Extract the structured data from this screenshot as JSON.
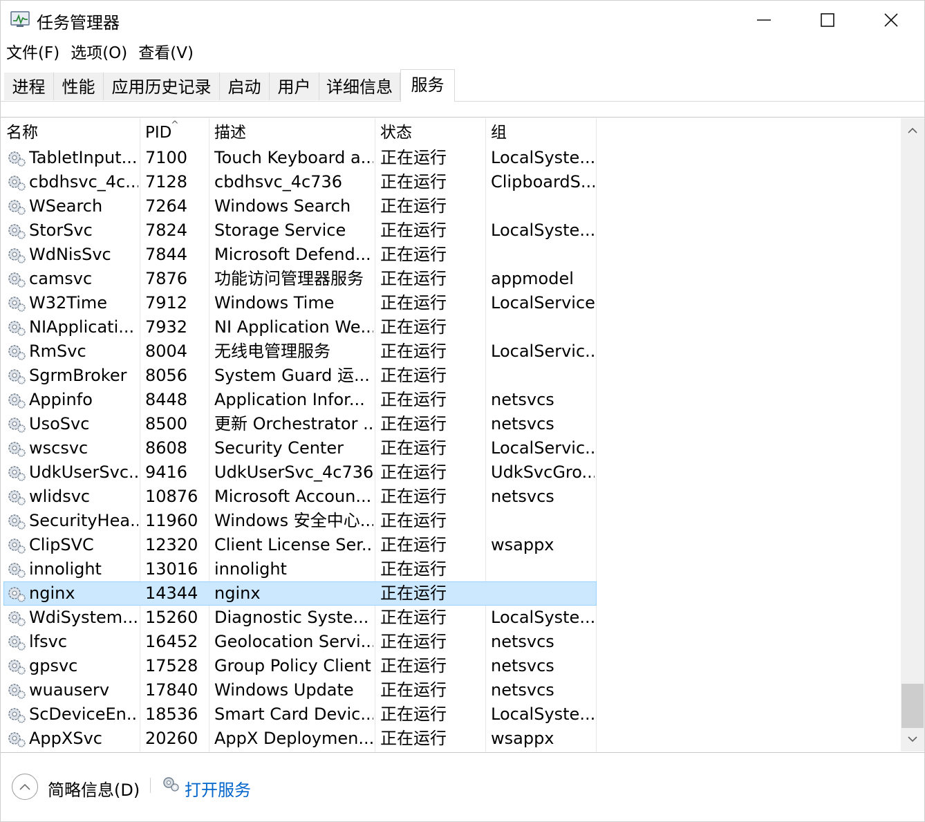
{
  "window": {
    "title": "任务管理器"
  },
  "menu": [
    "文件(F)",
    "选项(O)",
    "查看(V)"
  ],
  "tabs": [
    {
      "label": "进程"
    },
    {
      "label": "性能"
    },
    {
      "label": "应用历史记录"
    },
    {
      "label": "启动"
    },
    {
      "label": "用户"
    },
    {
      "label": "详细信息"
    },
    {
      "label": "服务",
      "active": true
    }
  ],
  "table": {
    "columns": {
      "name": "名称",
      "pid": "PID",
      "desc": "描述",
      "status": "状态",
      "group": "组"
    },
    "sort_indicator": "^",
    "row_icon": "service-gear-icon",
    "selected_index": 18,
    "rows": [
      {
        "name": "TabletInput...",
        "pid": "7100",
        "desc": "Touch Keyboard a...",
        "status": "正在运行",
        "group": "LocalSyste..."
      },
      {
        "name": "cbdhsvc_4c...",
        "pid": "7128",
        "desc": "cbdhsvc_4c736",
        "status": "正在运行",
        "group": "ClipboardS..."
      },
      {
        "name": "WSearch",
        "pid": "7264",
        "desc": "Windows Search",
        "status": "正在运行",
        "group": ""
      },
      {
        "name": "StorSvc",
        "pid": "7824",
        "desc": "Storage Service",
        "status": "正在运行",
        "group": "LocalSyste..."
      },
      {
        "name": "WdNisSvc",
        "pid": "7844",
        "desc": "Microsoft Defend...",
        "status": "正在运行",
        "group": ""
      },
      {
        "name": "camsvc",
        "pid": "7876",
        "desc": "功能访问管理器服务",
        "status": "正在运行",
        "group": "appmodel"
      },
      {
        "name": "W32Time",
        "pid": "7912",
        "desc": "Windows Time",
        "status": "正在运行",
        "group": "LocalService"
      },
      {
        "name": "NIApplicati...",
        "pid": "7932",
        "desc": "NI Application We...",
        "status": "正在运行",
        "group": ""
      },
      {
        "name": "RmSvc",
        "pid": "8004",
        "desc": "无线电管理服务",
        "status": "正在运行",
        "group": "LocalServic..."
      },
      {
        "name": "SgrmBroker",
        "pid": "8056",
        "desc": "System Guard 运...",
        "status": "正在运行",
        "group": ""
      },
      {
        "name": "Appinfo",
        "pid": "8448",
        "desc": "Application Infor...",
        "status": "正在运行",
        "group": "netsvcs"
      },
      {
        "name": "UsoSvc",
        "pid": "8500",
        "desc": "更新 Orchestrator ...",
        "status": "正在运行",
        "group": "netsvcs"
      },
      {
        "name": "wscsvc",
        "pid": "8608",
        "desc": "Security Center",
        "status": "正在运行",
        "group": "LocalServic..."
      },
      {
        "name": "UdkUserSvc...",
        "pid": "9416",
        "desc": "UdkUserSvc_4c736",
        "status": "正在运行",
        "group": "UdkSvcGro..."
      },
      {
        "name": "wlidsvc",
        "pid": "10876",
        "desc": "Microsoft Accoun...",
        "status": "正在运行",
        "group": "netsvcs"
      },
      {
        "name": "SecurityHea...",
        "pid": "11960",
        "desc": "Windows 安全中心...",
        "status": "正在运行",
        "group": ""
      },
      {
        "name": "ClipSVC",
        "pid": "12320",
        "desc": "Client License Ser...",
        "status": "正在运行",
        "group": "wsappx"
      },
      {
        "name": "innolight",
        "pid": "13016",
        "desc": "innolight",
        "status": "正在运行",
        "group": ""
      },
      {
        "name": "nginx",
        "pid": "14344",
        "desc": "nginx",
        "status": "正在运行",
        "group": ""
      },
      {
        "name": "WdiSystem...",
        "pid": "15260",
        "desc": "Diagnostic Syste...",
        "status": "正在运行",
        "group": "LocalSyste..."
      },
      {
        "name": "lfsvc",
        "pid": "16452",
        "desc": "Geolocation Servi...",
        "status": "正在运行",
        "group": "netsvcs"
      },
      {
        "name": "gpsvc",
        "pid": "17528",
        "desc": "Group Policy Client",
        "status": "正在运行",
        "group": "netsvcs"
      },
      {
        "name": "wuauserv",
        "pid": "17840",
        "desc": "Windows Update",
        "status": "正在运行",
        "group": "netsvcs"
      },
      {
        "name": "ScDeviceEn...",
        "pid": "18536",
        "desc": "Smart Card Devic...",
        "status": "正在运行",
        "group": "LocalSyste..."
      },
      {
        "name": "AppXSvc",
        "pid": "20260",
        "desc": "AppX Deploymen...",
        "status": "正在运行",
        "group": "wsappx"
      }
    ]
  },
  "footer": {
    "less_details": "简略信息(D)",
    "open_services": "打开服务"
  },
  "colors": {
    "selection_bg": "#cce8ff",
    "selection_border": "#99d1ff",
    "link": "#0066cc",
    "tab_inactive_bg": "#f0f0f0"
  }
}
